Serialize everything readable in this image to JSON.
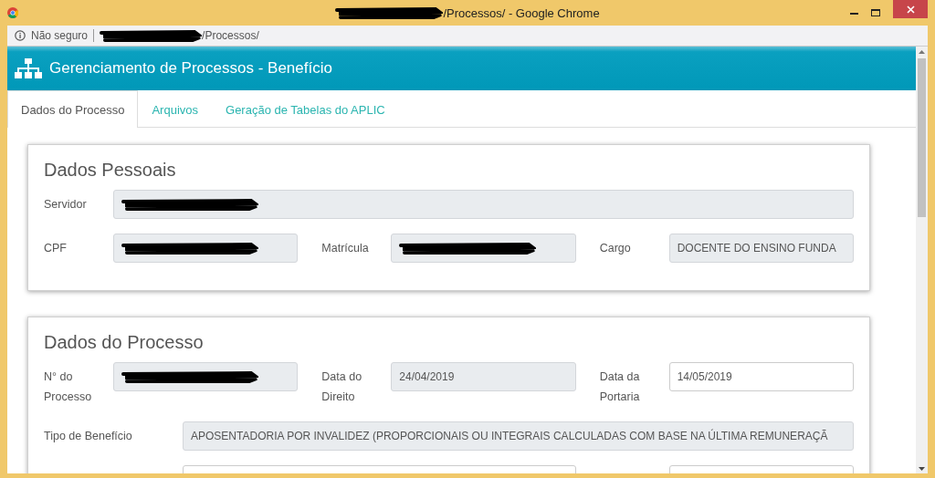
{
  "window": {
    "title": {
      "redacted_prefix": true,
      "text": "/Processos/ - Google Chrome"
    }
  },
  "address_bar": {
    "security": "Não seguro",
    "redacted_host": true,
    "path": "/Processos/"
  },
  "header": {
    "title": "Gerenciamento de Processos - Benefício"
  },
  "tabs": [
    {
      "label": "Dados do Processo",
      "selected": true
    },
    {
      "label": "Arquivos",
      "selected": false
    },
    {
      "label": "Geração de Tabelas do APLIC",
      "selected": false
    }
  ],
  "cards": [
    {
      "title": "Dados Pessoais",
      "rows": [
        {
          "kind": "full",
          "fields": [
            {
              "label": "Servidor",
              "redacted": true,
              "disabled": true
            }
          ]
        },
        {
          "kind": "triple",
          "fields": [
            {
              "label": "CPF",
              "redacted": true,
              "disabled": true
            },
            {
              "label": "Matrícula",
              "redacted": true,
              "disabled": true
            },
            {
              "label": "Cargo",
              "value": "DOCENTE DO ENSINO FUNDA",
              "disabled": true
            }
          ]
        }
      ]
    },
    {
      "title": "Dados do Processo",
      "rows": [
        {
          "kind": "triple",
          "fields": [
            {
              "label": "N° do Processo",
              "redacted": true,
              "disabled": true
            },
            {
              "label": "Data do Direito",
              "value": "24/04/2019",
              "disabled": true
            },
            {
              "label": "Data da Portaria",
              "value": "14/05/2019",
              "disabled": false
            }
          ]
        },
        {
          "kind": "wide",
          "fields": [
            {
              "label": "Tipo de Benefício",
              "value": "APOSENTADORIA POR INVALIDEZ (PROPORCIONAIS OU INTEGRAIS CALCULADAS COM BASE NA ÚLTIMA REMUNERAÇÃ",
              "disabled": true
            }
          ]
        },
        {
          "kind": "pair",
          "fields": [
            {
              "disabled": false
            },
            {
              "disabled": false
            }
          ]
        }
      ]
    }
  ]
}
